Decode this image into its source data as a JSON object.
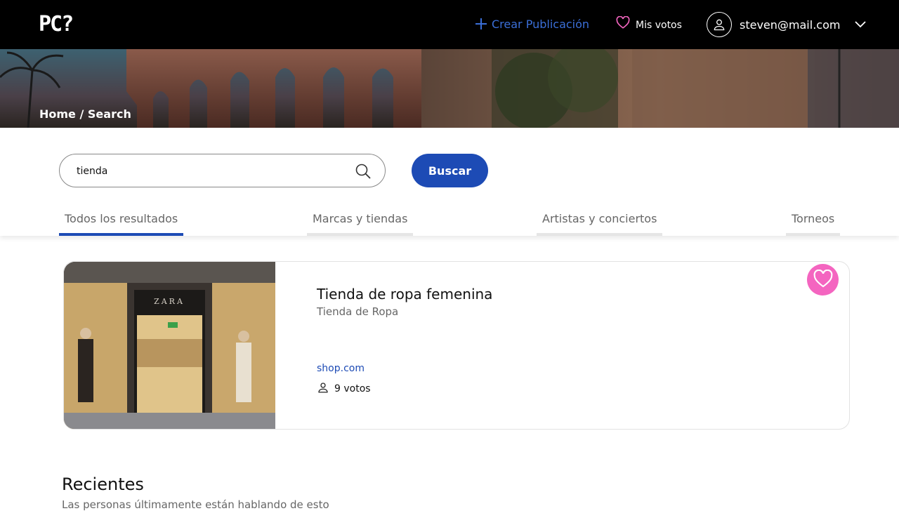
{
  "navbar": {
    "logo": "PC?",
    "create_label": "Crear Publicación",
    "votes_label": "Mis votos",
    "user_email": "steven@mail.com"
  },
  "hero": {
    "breadcrumb": "Home / Search"
  },
  "search": {
    "value": "tienda",
    "button_label": "Buscar"
  },
  "tabs": [
    {
      "label": "Todos los resultados",
      "active": true
    },
    {
      "label": "Marcas y tiendas",
      "active": false
    },
    {
      "label": "Artistas y conciertos",
      "active": false
    },
    {
      "label": "Torneos",
      "active": false
    }
  ],
  "result": {
    "image_sign": "ZARA",
    "title": "Tienda de ropa femenina",
    "category": "Tienda de Ropa",
    "link": "shop.com",
    "votes": "9 votos"
  },
  "recent": {
    "title": "Recientes",
    "subtitle": "Las personas últimamente están hablando de esto"
  },
  "colors": {
    "accent": "#1d4bb5",
    "favorite": "#f465c0",
    "navbar": "#000000"
  }
}
